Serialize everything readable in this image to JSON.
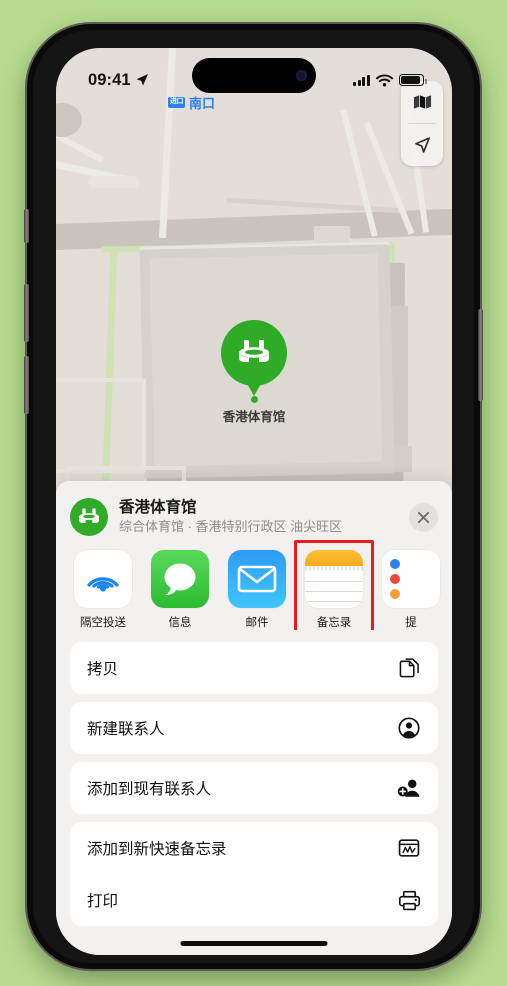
{
  "background_color": "#b5dc8e",
  "status_bar": {
    "time": "09:41",
    "location_arrow_icon": "location-arrow-icon",
    "cellular_icon": "cellular-signal-icon",
    "wifi_icon": "wifi-icon",
    "battery_icon": "battery-icon"
  },
  "map": {
    "entrance_badge": "进口",
    "entrance_label": "南口",
    "pin_label": "香港体育馆",
    "pin_color": "#2fab28",
    "controls": [
      {
        "name": "map-type-button",
        "icon": "folded-map-icon"
      },
      {
        "name": "user-location-button",
        "icon": "navigation-arrow-icon"
      }
    ]
  },
  "share_sheet": {
    "title": "香港体育馆",
    "subtitle": "综合体育馆 · 香港特别行政区 油尖旺区",
    "place_icon": "stadium-icon",
    "close_label": "×",
    "apps": [
      {
        "label": "隔空投送",
        "icon": "airdrop-icon",
        "highlighted": false
      },
      {
        "label": "信息",
        "icon": "messages-icon",
        "highlighted": false
      },
      {
        "label": "邮件",
        "icon": "mail-icon",
        "highlighted": false
      },
      {
        "label": "备忘录",
        "icon": "notes-icon",
        "highlighted": true
      },
      {
        "label": "提",
        "icon": "reminders-icon",
        "highlighted": false
      }
    ],
    "highlight_color": "#f01c1c",
    "actions": [
      {
        "label": "拷贝",
        "icon": "copy-icon"
      },
      {
        "label": "新建联系人",
        "icon": "person-circle-icon"
      },
      {
        "label": "添加到现有联系人",
        "icon": "person-add-icon"
      },
      {
        "label": "添加到新快速备忘录",
        "icon": "quick-note-icon"
      },
      {
        "label": "打印",
        "icon": "printer-icon"
      }
    ]
  }
}
